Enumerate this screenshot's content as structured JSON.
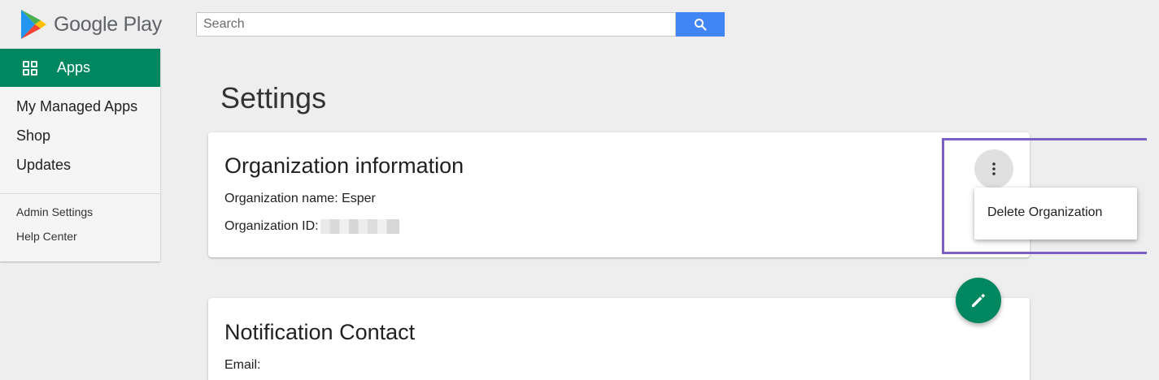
{
  "header": {
    "brand": "Google Play",
    "search_placeholder": "Search",
    "search_icon": "search-icon"
  },
  "sidebar": {
    "active_tab": "Apps",
    "active_icon": "grid-icon",
    "items": [
      {
        "label": "My Managed Apps"
      },
      {
        "label": "Shop"
      },
      {
        "label": "Updates"
      }
    ],
    "sub_items": [
      {
        "label": "Admin Settings"
      },
      {
        "label": "Help Center"
      }
    ]
  },
  "main": {
    "title": "Settings",
    "org_card": {
      "title": "Organization information",
      "name_label": "Organization name: Esper",
      "id_label": "Organization ID:"
    },
    "overflow_menu": {
      "icon": "more-vert-icon",
      "items": [
        {
          "label": "Delete Organization"
        }
      ]
    },
    "notif_card": {
      "title": "Notification Contact",
      "email_label": "Email:"
    },
    "fab_icon": "pencil-icon"
  },
  "colors": {
    "brand_green": "#01875f",
    "search_blue": "#4285f4",
    "highlight": "#7b5ec6"
  }
}
